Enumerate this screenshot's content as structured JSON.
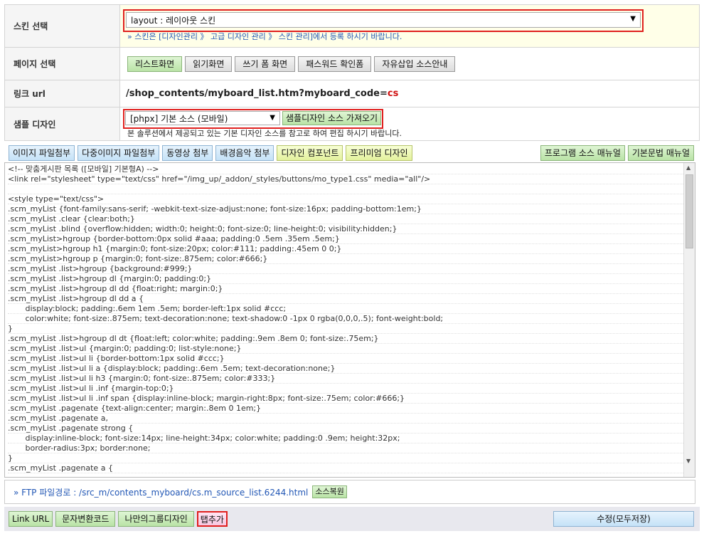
{
  "skin": {
    "label": "스킨 선택",
    "select_value": "layout : 레이아웃 스킨",
    "note": "» 스킨은 [디자인관리 》 고급 디자인 관리 》 스킨 관리]에서 등록 하시기 바랍니다."
  },
  "page": {
    "label": "페이지 선택",
    "buttons": [
      "리스트화면",
      "읽기화면",
      "쓰기 폼 화면",
      "패스워드 확인폼",
      "자유삽입 소스안내"
    ]
  },
  "link": {
    "label": "링크 url",
    "url_prefix": "/shop_contents/myboard_list.htm?myboard_code=",
    "url_code": "cs"
  },
  "sample": {
    "label": "샘플 디자인",
    "select_value": "[phpx] 기본 소스 (모바일)",
    "fetch_button": "샘플디자인 소스 가져오기",
    "note": "본 솔루션에서 제공되고 있는 기본 디자인 소스를 참고로 하여 편집 하시기 바랍니다."
  },
  "toolbar": {
    "left": [
      {
        "label": "이미지 파일첨부",
        "style": "blue"
      },
      {
        "label": "다중이미지 파일첨부",
        "style": "blue"
      },
      {
        "label": "동영상 첨부",
        "style": "blue"
      },
      {
        "label": "배경음악 첨부",
        "style": "blue"
      },
      {
        "label": "디자인 컴포넌트",
        "style": "yel"
      },
      {
        "label": "프리미엄 디자인",
        "style": "yel"
      }
    ],
    "right": [
      {
        "label": "프로그램 소스 매뉴얼",
        "style": "green"
      },
      {
        "label": "기본문법 매뉴얼",
        "style": "green"
      }
    ]
  },
  "code_lines": [
    "<!-- 맞춤게시판 목록 ([모바일] 기본형A) -->",
    "<link rel=\"stylesheet\" type=\"text/css\" href=\"/img_up/_addon/_styles/buttons/mo_type1.css\" media=\"all\"/>",
    "",
    "<style type=\"text/css\">",
    ".scm_myList {font-family:sans-serif; -webkit-text-size-adjust:none; font-size:16px; padding-bottom:1em;}",
    ".scm_myList .clear {clear:both;}",
    ".scm_myList .blind {overflow:hidden; width:0; height:0; font-size:0; line-height:0; visibility:hidden;}",
    ".scm_myList>hgroup {border-bottom:0px solid #aaa; padding:0 .5em .35em .5em;}",
    ".scm_myList>hgroup h1 {margin:0; font-size:20px; color:#111; padding:.45em 0 0;}",
    ".scm_myList>hgroup p {margin:0; font-size:.875em; color:#666;}",
    ".scm_myList .list>hgroup {background:#999;}",
    ".scm_myList .list>hgroup dl {margin:0; padding:0;}",
    ".scm_myList .list>hgroup dl dd {float:right; margin:0;}",
    ".scm_myList .list>hgroup dl dd a {",
    "       display:block; padding:.6em 1em .5em; border-left:1px solid #ccc;",
    "       color:white; font-size:.875em; text-decoration:none; text-shadow:0 -1px 0 rgba(0,0,0,.5); font-weight:bold;",
    "}",
    ".scm_myList .list>hgroup dl dt {float:left; color:white; padding:.9em .8em 0; font-size:.75em;}",
    ".scm_myList .list>ul {margin:0; padding:0; list-style:none;}",
    ".scm_myList .list>ul li {border-bottom:1px solid #ccc;}",
    ".scm_myList .list>ul li a {display:block; padding:.6em .5em; text-decoration:none;}",
    ".scm_myList .list>ul li h3 {margin:0; font-size:.875em; color:#333;}",
    ".scm_myList .list>ul li .inf {margin-top:0;}",
    ".scm_myList .list>ul li .inf span {display:inline-block; margin-right:8px; font-size:.75em; color:#666;}",
    ".scm_myList .pagenate {text-align:center; margin:.8em 0 1em;}",
    ".scm_myList .pagenate a,",
    ".scm_myList .pagenate strong {",
    "       display:inline-block; font-size:14px; line-height:34px; color:white; padding:0 .9em; height:32px;",
    "       border-radius:3px; border:none;",
    "}",
    ".scm_myList .pagenate a {"
  ],
  "ftp": {
    "prefix": "»  FTP 파일경로 : /src_m/contents_myboard/cs.m_source_list.6244.html",
    "restore_button": "소스복원"
  },
  "bottom": {
    "buttons": [
      "Link URL",
      "문자변환코드",
      "나만의그룹디자인",
      "탭추가"
    ],
    "save_button": "수정(모두저장)"
  }
}
